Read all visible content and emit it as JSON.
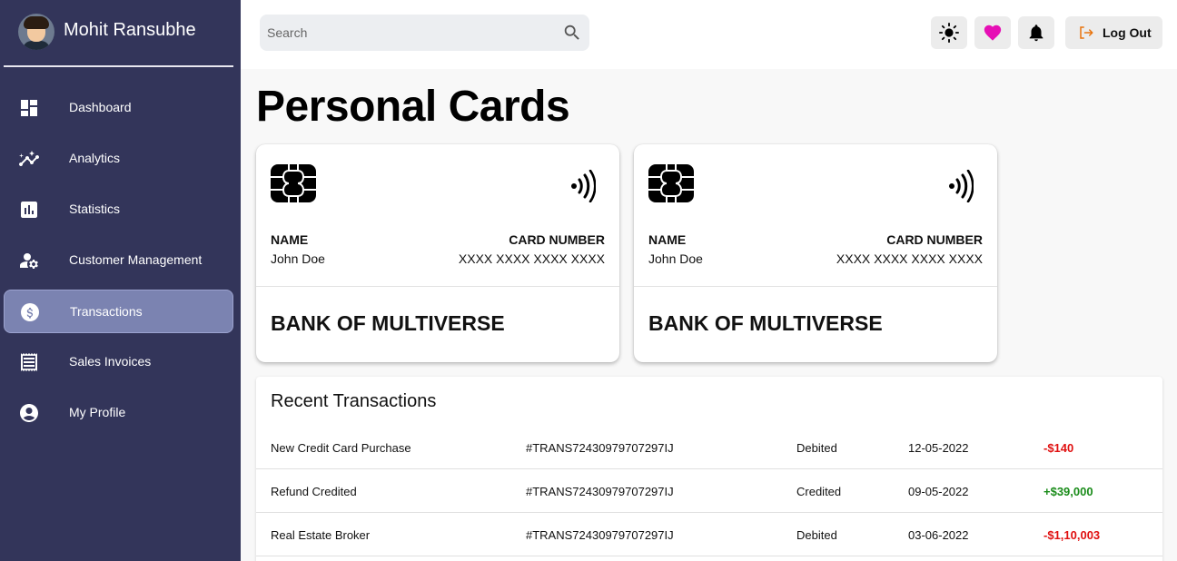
{
  "user": {
    "name": "Mohit Ransubhe"
  },
  "sidebar": {
    "items": [
      {
        "label": "Dashboard",
        "icon": "dashboard-icon"
      },
      {
        "label": "Analytics",
        "icon": "analytics-icon"
      },
      {
        "label": "Statistics",
        "icon": "statistics-icon"
      },
      {
        "label": "Customer Management",
        "icon": "customer-management-icon"
      },
      {
        "label": "Transactions",
        "icon": "dollar-icon",
        "active": true
      },
      {
        "label": "Sales Invoices",
        "icon": "invoice-icon"
      },
      {
        "label": "My Profile",
        "icon": "account-circle-icon"
      }
    ]
  },
  "topbar": {
    "search_placeholder": "Search",
    "logout_label": "Log Out"
  },
  "page": {
    "title": "Personal Cards"
  },
  "cards": [
    {
      "name_label": "NAME",
      "name": "John Doe",
      "number_label": "CARD NUMBER",
      "number": "XXXX XXXX XXXX XXXX",
      "bank": "BANK OF MULTIVERSE"
    },
    {
      "name_label": "NAME",
      "name": "John Doe",
      "number_label": "CARD NUMBER",
      "number": "XXXX XXXX XXXX XXXX",
      "bank": "BANK OF MULTIVERSE"
    }
  ],
  "transactions": {
    "title": "Recent Transactions",
    "rows": [
      {
        "description": "New Credit Card Purchase",
        "id": "#TRANS72430979707297IJ",
        "type": "Debited",
        "date": "12-05-2022",
        "amount": "-$140"
      },
      {
        "description": "Refund Credited",
        "id": "#TRANS72430979707297IJ",
        "type": "Credited",
        "date": "09-05-2022",
        "amount": "+$39,000"
      },
      {
        "description": "Real Estate Broker",
        "id": "#TRANS72430979707297IJ",
        "type": "Debited",
        "date": "03-06-2022",
        "amount": "-$1,10,003"
      }
    ]
  },
  "colors": {
    "sidebar_bg": "#33355a",
    "active_item_bg": "#7b83b1",
    "heart": "#e60fb5",
    "logout_icon": "#e8730c",
    "negative": "#e01010",
    "positive": "#1a8c1a"
  }
}
